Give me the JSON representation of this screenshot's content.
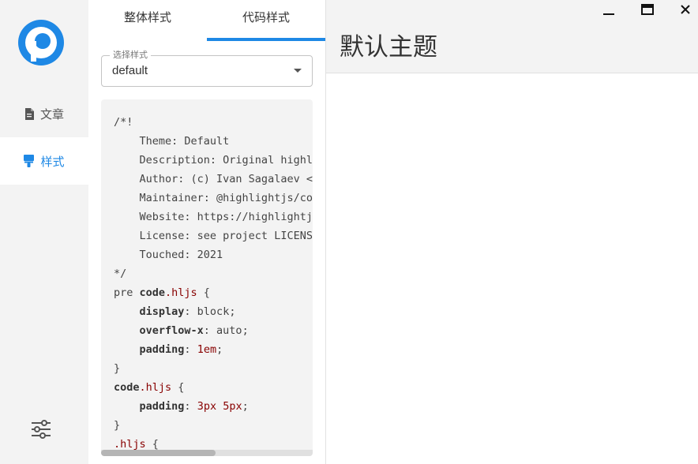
{
  "sidebar": {
    "items": [
      {
        "label": "文章",
        "icon": "document-icon",
        "active": false
      },
      {
        "label": "样式",
        "icon": "brush-icon",
        "active": true
      }
    ],
    "settings_icon": "sliders-icon"
  },
  "tabs": [
    {
      "label": "整体样式",
      "active": false
    },
    {
      "label": "代码样式",
      "active": true
    }
  ],
  "theme_select": {
    "label": "选择样式",
    "value": "default"
  },
  "code": {
    "lines": [
      "/*!",
      "    Theme: Default",
      "    Description: Original highli",
      "    Author: (c) Ivan Sagalaev <m",
      "    Maintainer: @highlightjs/cor",
      "    Website: https://highlightjs",
      "    License: see project LICENSE",
      "    Touched: 2021",
      "*/",
      "pre code.hljs {",
      "    display: block;",
      "    overflow-x: auto;",
      "    padding: 1em;",
      "}",
      "code.hljs {",
      "    padding: 3px 5px;",
      "}",
      ".hljs {"
    ],
    "scroll_position": 0.0
  },
  "preview": {
    "title": "默认主题"
  },
  "window_controls": [
    "minimize-icon",
    "maximize-icon",
    "close-icon"
  ],
  "colors": {
    "accent": "#1e88e5",
    "logo": "#1e88e5",
    "code_selector": "#880000"
  }
}
